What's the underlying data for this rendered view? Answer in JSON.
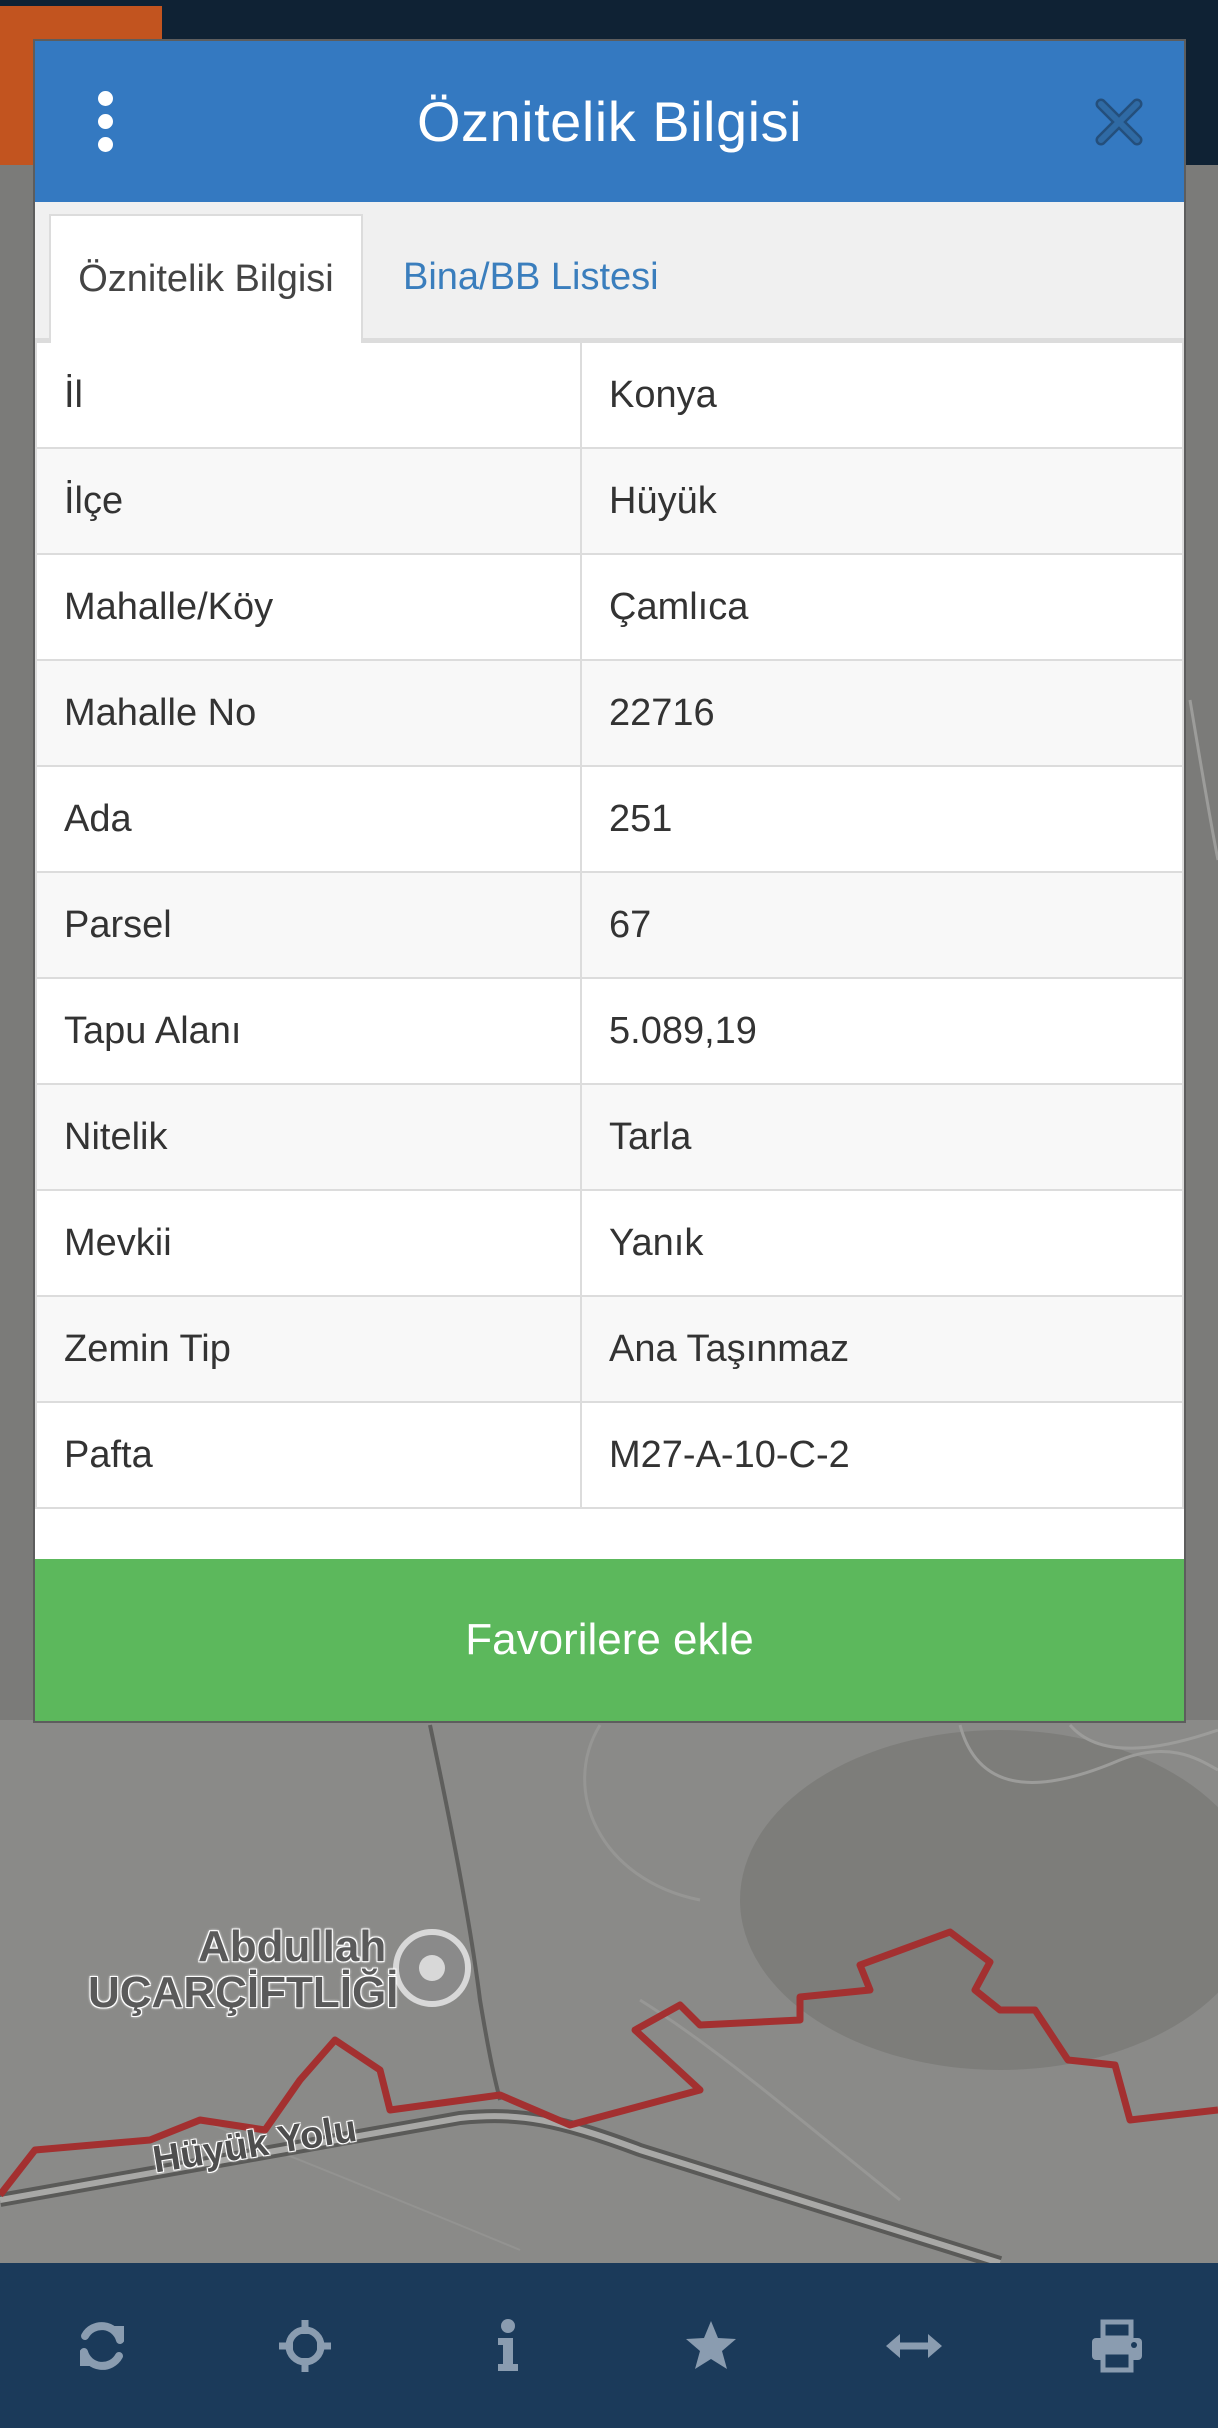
{
  "modal": {
    "title": "Öznitelik Bilgisi",
    "tabs": [
      {
        "label": "Öznitelik Bilgisi",
        "active": true
      },
      {
        "label": "Bina/BB Listesi",
        "active": false
      }
    ],
    "rows": [
      {
        "key": "İl",
        "value": "Konya"
      },
      {
        "key": "İlçe",
        "value": "Hüyük"
      },
      {
        "key": "Mahalle/Köy",
        "value": "Çamlıca"
      },
      {
        "key": "Mahalle No",
        "value": "22716"
      },
      {
        "key": "Ada",
        "value": "251"
      },
      {
        "key": "Parsel",
        "value": "67"
      },
      {
        "key": "Tapu Alanı",
        "value": "5.089,19"
      },
      {
        "key": "Nitelik",
        "value": "Tarla"
      },
      {
        "key": "Mevkii",
        "value": "Yanık"
      },
      {
        "key": "Zemin Tip",
        "value": "Ana Taşınmaz"
      },
      {
        "key": "Pafta",
        "value": "M27-A-10-C-2"
      }
    ],
    "favorite_button": "Favorilere ekle"
  },
  "map": {
    "place_label_line1": "Abdullah",
    "place_label_line2": "UÇARÇİFTLİĞİ",
    "road_label": "Hüyük Yolu"
  },
  "toolbar": {
    "icons": [
      "refresh-icon",
      "crosshair-icon",
      "info-icon",
      "star-icon",
      "arrows-horizontal-icon",
      "print-icon"
    ]
  },
  "colors": {
    "header": "#3479c1",
    "favorite": "#5cb85c",
    "toolbar": "#1b3a5a",
    "tab_link": "#3a7ebd",
    "parcel_border": "#a33030"
  }
}
